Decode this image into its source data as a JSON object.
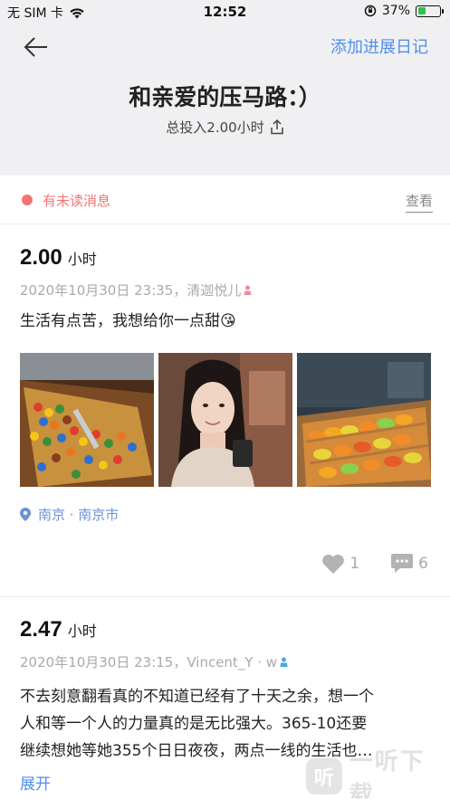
{
  "status": {
    "carrier": "无 SIM 卡",
    "time": "12:52",
    "battery": "37%",
    "battery_level": 0.37
  },
  "header": {
    "add_diary": "添加进展日记",
    "title": "和亲爱的压马路：）",
    "total_label": "总投入2.00小时"
  },
  "unread": {
    "text": "有未读消息",
    "view": "查看"
  },
  "posts": [
    {
      "hours": "2.00",
      "unit": "小时",
      "meta": "2020年10月30日 23:35，清迦悦儿",
      "text": "生活有点苦，我想给你一点甜😘",
      "location": "南京 · 南京市",
      "likes": "1",
      "comments": "6"
    },
    {
      "hours": "2.47",
      "unit": "小时",
      "meta": "2020年10月30日 23:15，Vincent_Y · w",
      "lines": [
        "不去刻意翻看真的不知道已经有了十天之余，想一个",
        "人和等一个人的力量真的是无比强大。365-10还要",
        "继续想她等她355个日日夜夜，两点一线的生活也…"
      ],
      "expand": "展开"
    }
  ],
  "watermark": {
    "badge": "听",
    "text": "一听下载"
  },
  "colors": {
    "accent": "#4f8ef0",
    "unread": "#f37474",
    "female": "#f08aa0",
    "male": "#4aa8e8"
  }
}
